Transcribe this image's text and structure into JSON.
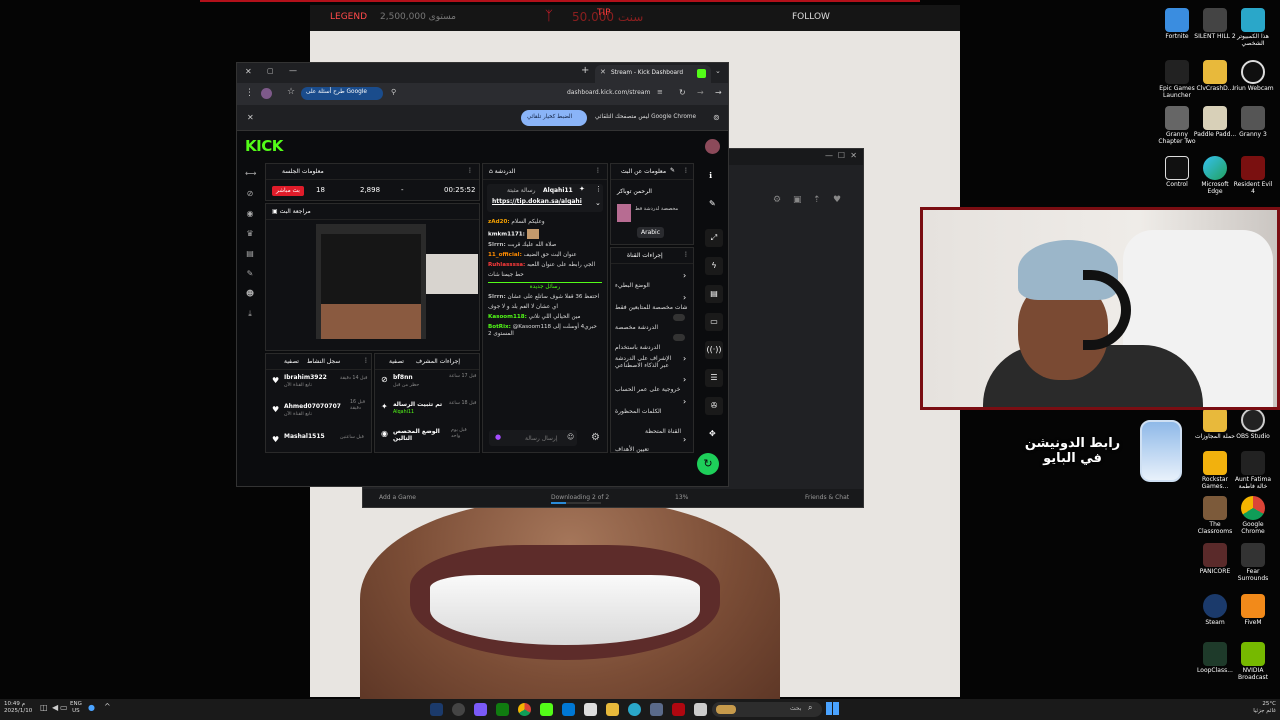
{
  "overlay": {
    "legend": "LEGEND",
    "legend_val": "2,500,000 مستوى",
    "tip": "TIP",
    "tip_val": "50.000 سنت",
    "follow": "FOLLOW"
  },
  "desktop": {
    "col1": [
      "Fortnite",
      "Epic Games Launcher",
      "Granny Chapter Two",
      "Control"
    ],
    "col2": [
      "SILENT HILL 2",
      "ClvCrashD...",
      "Paddle Padd...",
      "Microsoft Edge"
    ],
    "col3": [
      "هذا الكمبيوتر الشخصي",
      "Iriun Webcam",
      "Granny 3",
      "Resident Evil 4"
    ],
    "lower_col2": [
      "حملة المجاوزات",
      "Rockstar Games..."
    ],
    "lower_col3": [
      "OBS Studio",
      "Aunt Fatima خالة فاطمة",
      "Google Chrome",
      "Fear Surrounds",
      "FiveM",
      "NVIDIA Broadcast"
    ],
    "lower_col1": [
      "The Classrooms",
      "PANICORE",
      "Steam",
      "LoopClass..."
    ],
    "donation": "رابط الدونيشن في البايو"
  },
  "browser": {
    "tab_title": "Stream - Kick Dashboard",
    "ask_google": "طرح أسئلة على Google",
    "url": "dashboard.kick.com/stream",
    "notice_text": "ليس متصفحك التلقائي Google Chrome",
    "notice_button": "الضبط كخيار تلقائي"
  },
  "kick": {
    "logo": "KICK",
    "session_title": "معلومات الجلسة",
    "live_badge": "بث مباشر",
    "viewers": "18",
    "followers": "2,898",
    "dash": "-",
    "uptime": "00:25:52",
    "review_title": "مراجعة البث",
    "chat_title": "الدردشة",
    "pinned_user": "Alqahi11",
    "pinned_label": "رسالة مثبتة",
    "pinned_link": "https://tip.dokan.sa/alqahi",
    "chat": [
      {
        "user": "zAd20:",
        "text": "وعليكم السلام",
        "color": "#f4a000"
      },
      {
        "user": "kmkm1171:",
        "text": "",
        "color": "#ffffff"
      },
      {
        "user": "Slrrn:",
        "text": "صلاة الله عليك قربت",
        "color": "#bdbdbd"
      },
      {
        "user": "11_official:",
        "text": "عنوان البث حق الضيف",
        "color": "#ff8c00"
      },
      {
        "user": "Ruhlassssa:",
        "text": "الجي رابطه على عنوان اللعبه",
        "color": "#ff3b3b"
      },
      {
        "user": "",
        "text": "حط جيمنا شات",
        "color": "#bdbdbd"
      },
      {
        "user": "",
        "text": "رسائل جديدة",
        "color": "#53fc18"
      },
      {
        "user": "Slrrn:",
        "text": "احتفظ 36 قفلا شوف ساتلع على عشان",
        "color": "#bdbdbd"
      },
      {
        "user": "",
        "text": "اي عشان لا الفم بلد و لا جوف",
        "color": "#bdbdbd"
      },
      {
        "user": "Kasoom118:",
        "text": "مين الحيالي اللي نلاني",
        "color": "#53fc18"
      },
      {
        "user": "BotRix:",
        "text": "@Kasoom118 حبري4 أوسلت إلى المستوى 2",
        "color": "#53fc18"
      }
    ],
    "chat_placeholder": "إرسال رسالة",
    "stream_info_title": "معلومات عن البث",
    "streamer_name": "الرحمن توباكر",
    "category": "مخصصة لدردشة قط",
    "language": "Arabic",
    "channel_actions_title": "إجراءات القناة",
    "channel_actions": [
      "الوضع البطيء",
      "شات مخصصة للمتابعين فقط",
      "الدردشة مخصصة",
      "الدردشة باستخدام",
      "الإشراف على الدردشة عبر الذكاء الاصطناعي",
      "خروجية على عمر الحساب",
      "الكلمات المحظورة",
      "القناة المتحظة",
      "تعيين الأهداف"
    ],
    "recent_title": "سجل النشاط",
    "recent_filter": "تصفية",
    "followers_list": [
      {
        "name": "Ibrahim3922",
        "sub": "تابع القناة الآن",
        "time": "قبل 14 دقيقة"
      },
      {
        "name": "Ahmed07070707",
        "sub": "تابع القناة الآن",
        "time": "قبل 16 دقيقة"
      },
      {
        "name": "Mashal1515",
        "sub": "",
        "time": "قبل ساعتين"
      }
    ],
    "mod_title": "إجراءات المشرف",
    "mod_filter": "تصفية",
    "mod_list": [
      {
        "name": "bf8nn",
        "sub": "حظر من قبل",
        "time": "قبل 17 ساعة"
      },
      {
        "name": "تم تثبيت الرسالة",
        "sub": "Alqahi11",
        "time": "قبل 18 ساعة"
      },
      {
        "name": "الوضع المخصص التالين",
        "sub": "",
        "time": "قبل يوم واحد"
      }
    ]
  },
  "launcher": {
    "add_game": "Add a Game",
    "downloading": "Downloading 2 of 2",
    "percent": "13%",
    "friends": "Friends & Chat"
  },
  "taskbar": {
    "lang": "ENG",
    "region": "US",
    "time": "10:49 م",
    "date": "2025/1/10",
    "weather": "25°C",
    "weather_desc": "غائم جزئيا",
    "search": "بحث"
  }
}
